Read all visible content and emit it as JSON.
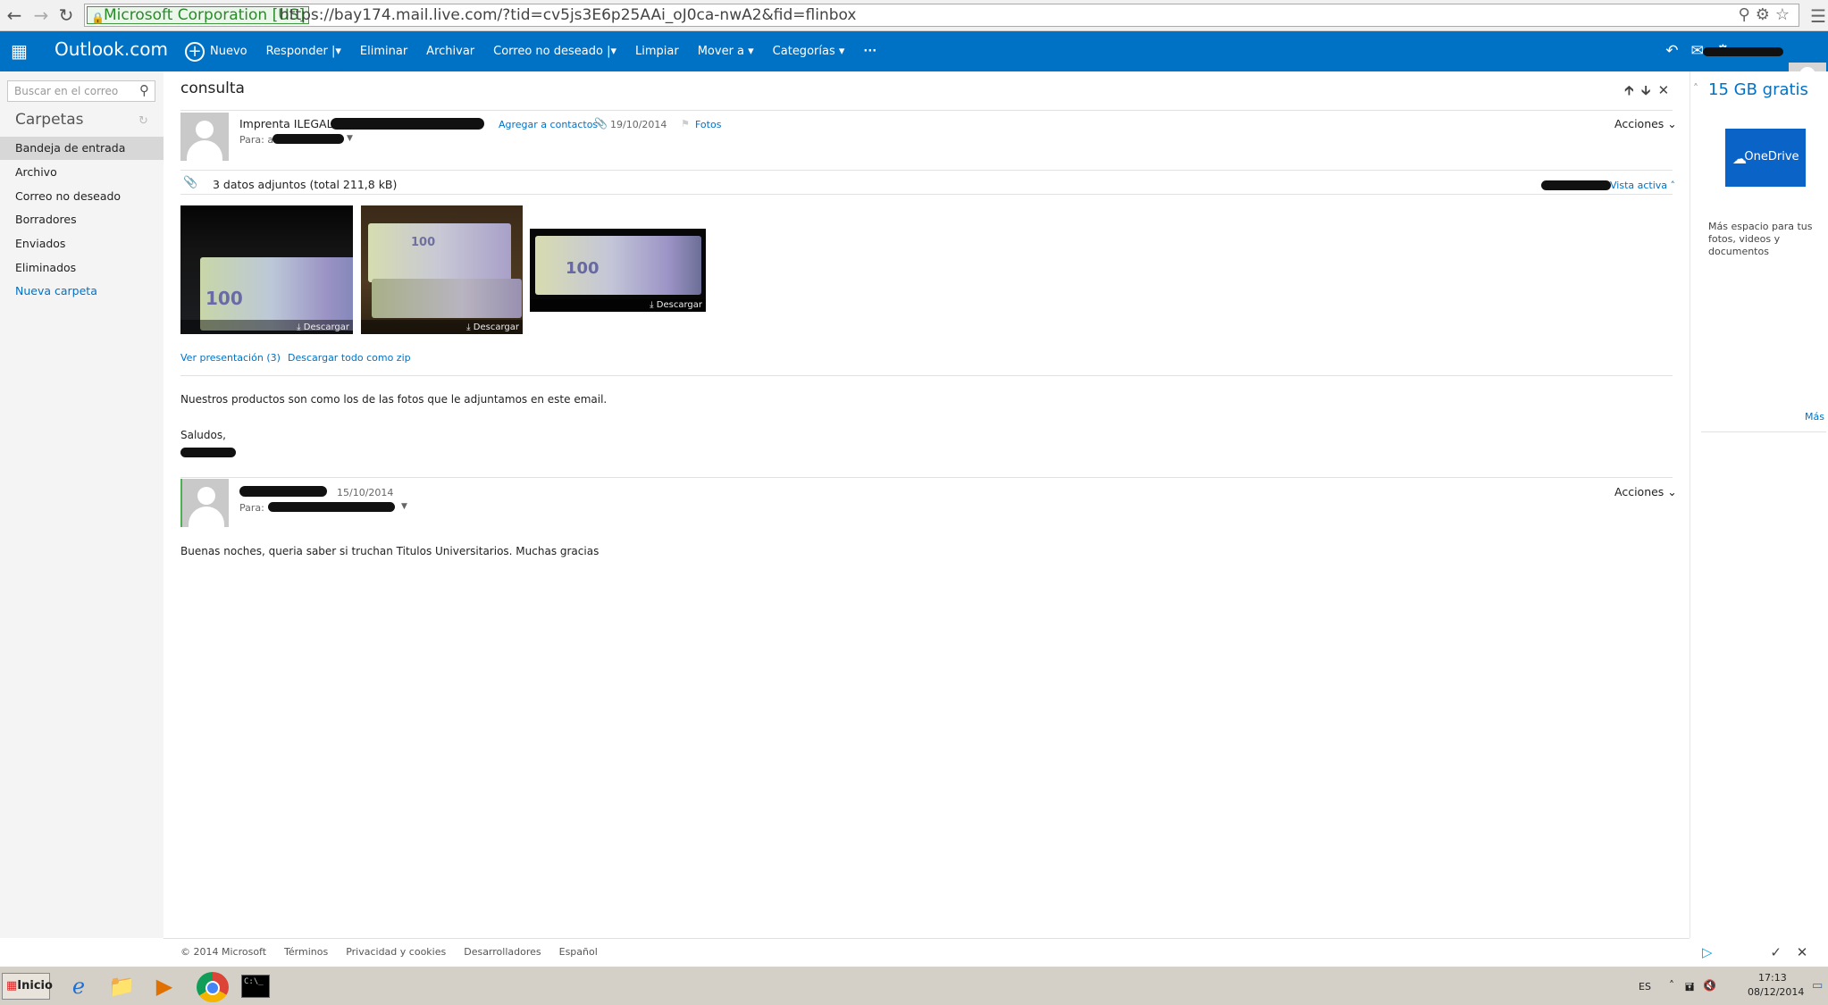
{
  "browser": {
    "ev_label": "Microsoft Corporation [US]",
    "url": "https://bay174.mail.live.com/?tid=cv5js3E6p25AAi_oJ0ca-nwA2&fid=flinbox"
  },
  "app": {
    "brand": "Outlook.com",
    "toolbar": {
      "nuevo": "Nuevo",
      "responder": "Responder |▾",
      "eliminar": "Eliminar",
      "archivar": "Archivar",
      "correo_no_deseado": "Correo no deseado |▾",
      "limpiar": "Limpiar",
      "mover": "Mover a ▾",
      "categorias": "Categorías ▾",
      "more": "···"
    }
  },
  "sidebar": {
    "search_placeholder": "Buscar en el correo",
    "folders_title": "Carpetas",
    "folders": [
      {
        "label": "Bandeja de entrada"
      },
      {
        "label": "Archivo"
      },
      {
        "label": "Correo no deseado"
      },
      {
        "label": "Borradores"
      },
      {
        "label": "Enviados"
      },
      {
        "label": "Eliminados"
      },
      {
        "label": "Nueva carpeta"
      }
    ]
  },
  "message": {
    "subject": "consulta",
    "first": {
      "sender": "Imprenta ILEGAL",
      "add_contacts": "Agregar a contactos",
      "date": "19/10/2014",
      "category": "Fotos",
      "to_label": "Para: a",
      "actions": "Acciones ⌄",
      "attachments_summary": "3 datos adjuntos (total 211,8 kB)",
      "view_active": "Vista activa ˄",
      "download_label": "Descargar",
      "ver_presentacion": "Ver presentación (3)",
      "descargar_zip": "Descargar todo como zip",
      "body": "Nuestros productos son como los de las fotos que le adjuntamos en este email.",
      "closing": "Saludos,"
    },
    "second": {
      "date": "15/10/2014",
      "to_label": "Para:",
      "actions": "Acciones ⌄",
      "body": "Buenas noches, queria saber si truchan Titulos Universitarios. Muchas gracias"
    }
  },
  "ad": {
    "title": "15 GB gratis",
    "onedrive": "OneDrive",
    "description": "Más espacio para tus fotos, videos y documentos",
    "more": "Más"
  },
  "footer": {
    "copyright": "© 2014 Microsoft",
    "terms": "Términos",
    "privacy": "Privacidad y cookies",
    "developers": "Desarrolladores",
    "language": "Español"
  },
  "taskbar": {
    "start": "Inicio",
    "lang": "ES",
    "time": "17:13",
    "date": "08/12/2014"
  }
}
